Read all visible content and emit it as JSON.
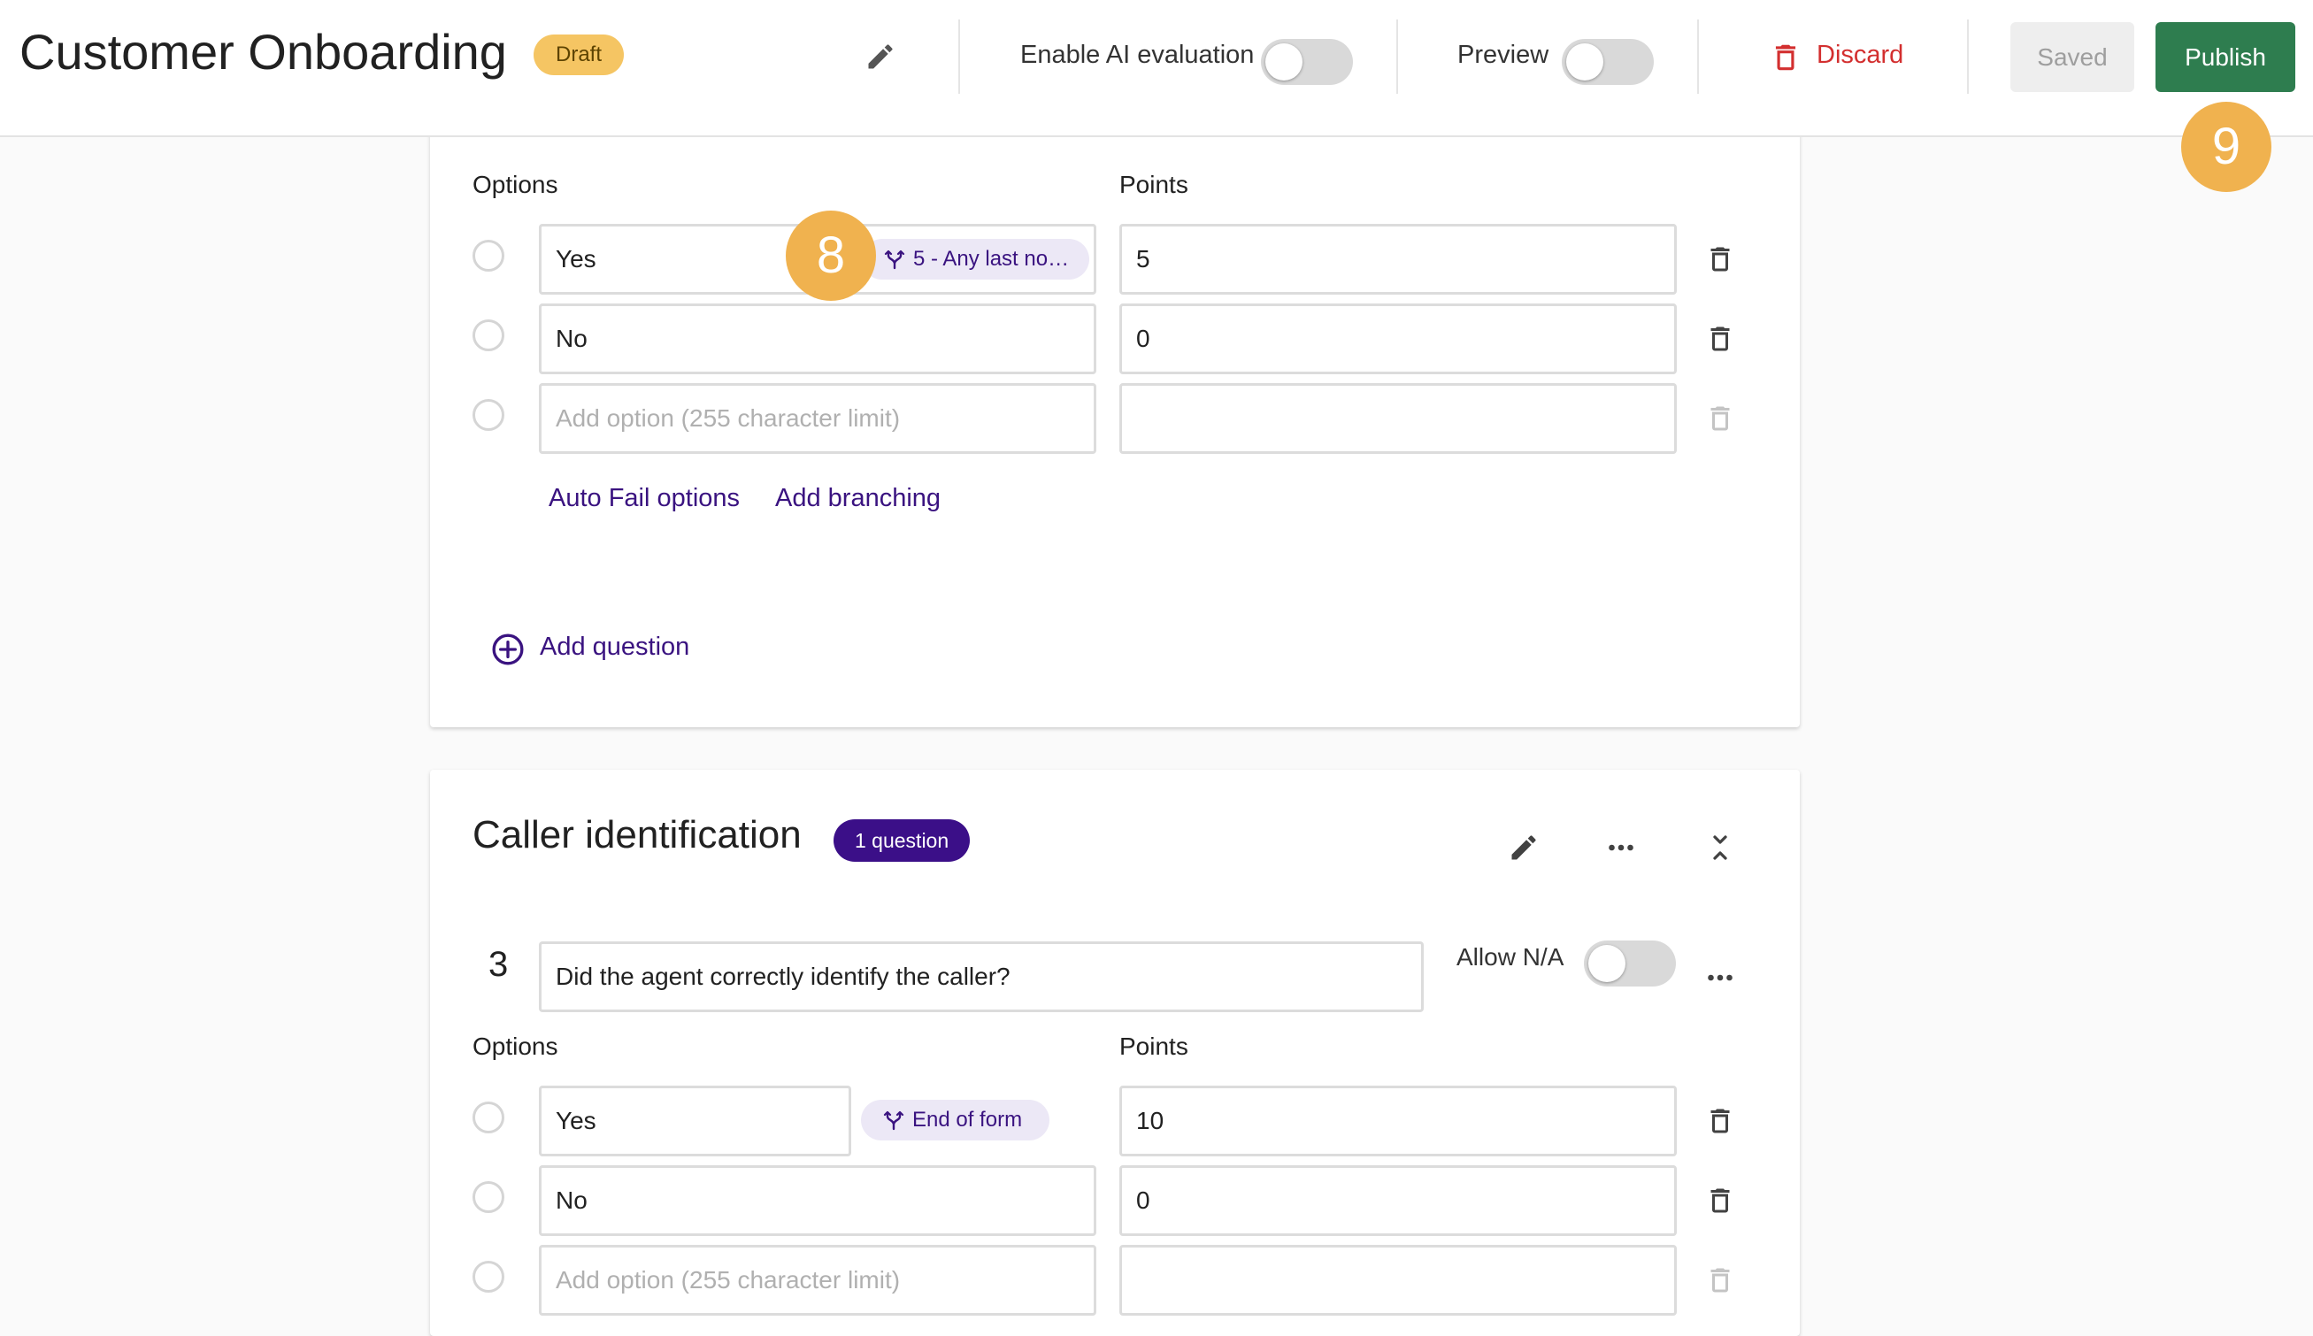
{
  "header": {
    "title": "Customer Onboarding",
    "status_badge": "Draft",
    "ai_eval_label": "Enable AI evaluation",
    "ai_eval_on": false,
    "preview_label": "Preview",
    "preview_on": false,
    "discard_label": "Discard",
    "saved_label": "Saved",
    "publish_label": "Publish"
  },
  "callouts": [
    "8",
    "9"
  ],
  "question_upper": {
    "options_heading": "Options",
    "points_heading": "Points",
    "options": [
      {
        "label": "Yes",
        "points": "5",
        "branch": "5 - Any last no…"
      },
      {
        "label": "No",
        "points": "0"
      }
    ],
    "add_option_placeholder": "Add option (255 character limit)",
    "auto_fail_label": "Auto Fail options",
    "add_branching_label": "Add branching",
    "add_question_label": "Add question"
  },
  "section_caller": {
    "title": "Caller identification",
    "count_badge": "1 question",
    "question": {
      "number": "3",
      "text": "Did the agent correctly identify the caller?",
      "allow_na_label": "Allow N/A",
      "allow_na_on": false,
      "options_heading": "Options",
      "points_heading": "Points",
      "options": [
        {
          "label": "Yes",
          "points": "10",
          "branch": "End of form"
        },
        {
          "label": "No",
          "points": "0"
        }
      ],
      "add_option_placeholder": "Add option (255 character limit)"
    }
  },
  "colors": {
    "brand_purple": "#3b0f88",
    "publish_green": "#2e7d4f",
    "discard_red": "#d32f2f",
    "draft_yellow": "#f5c563",
    "callout_orange": "#f0b24f"
  },
  "icons": [
    "pencil-icon",
    "trash-icon",
    "branch-icon",
    "plus-circle-icon",
    "more-horizontal-icon",
    "collapse-icon"
  ]
}
